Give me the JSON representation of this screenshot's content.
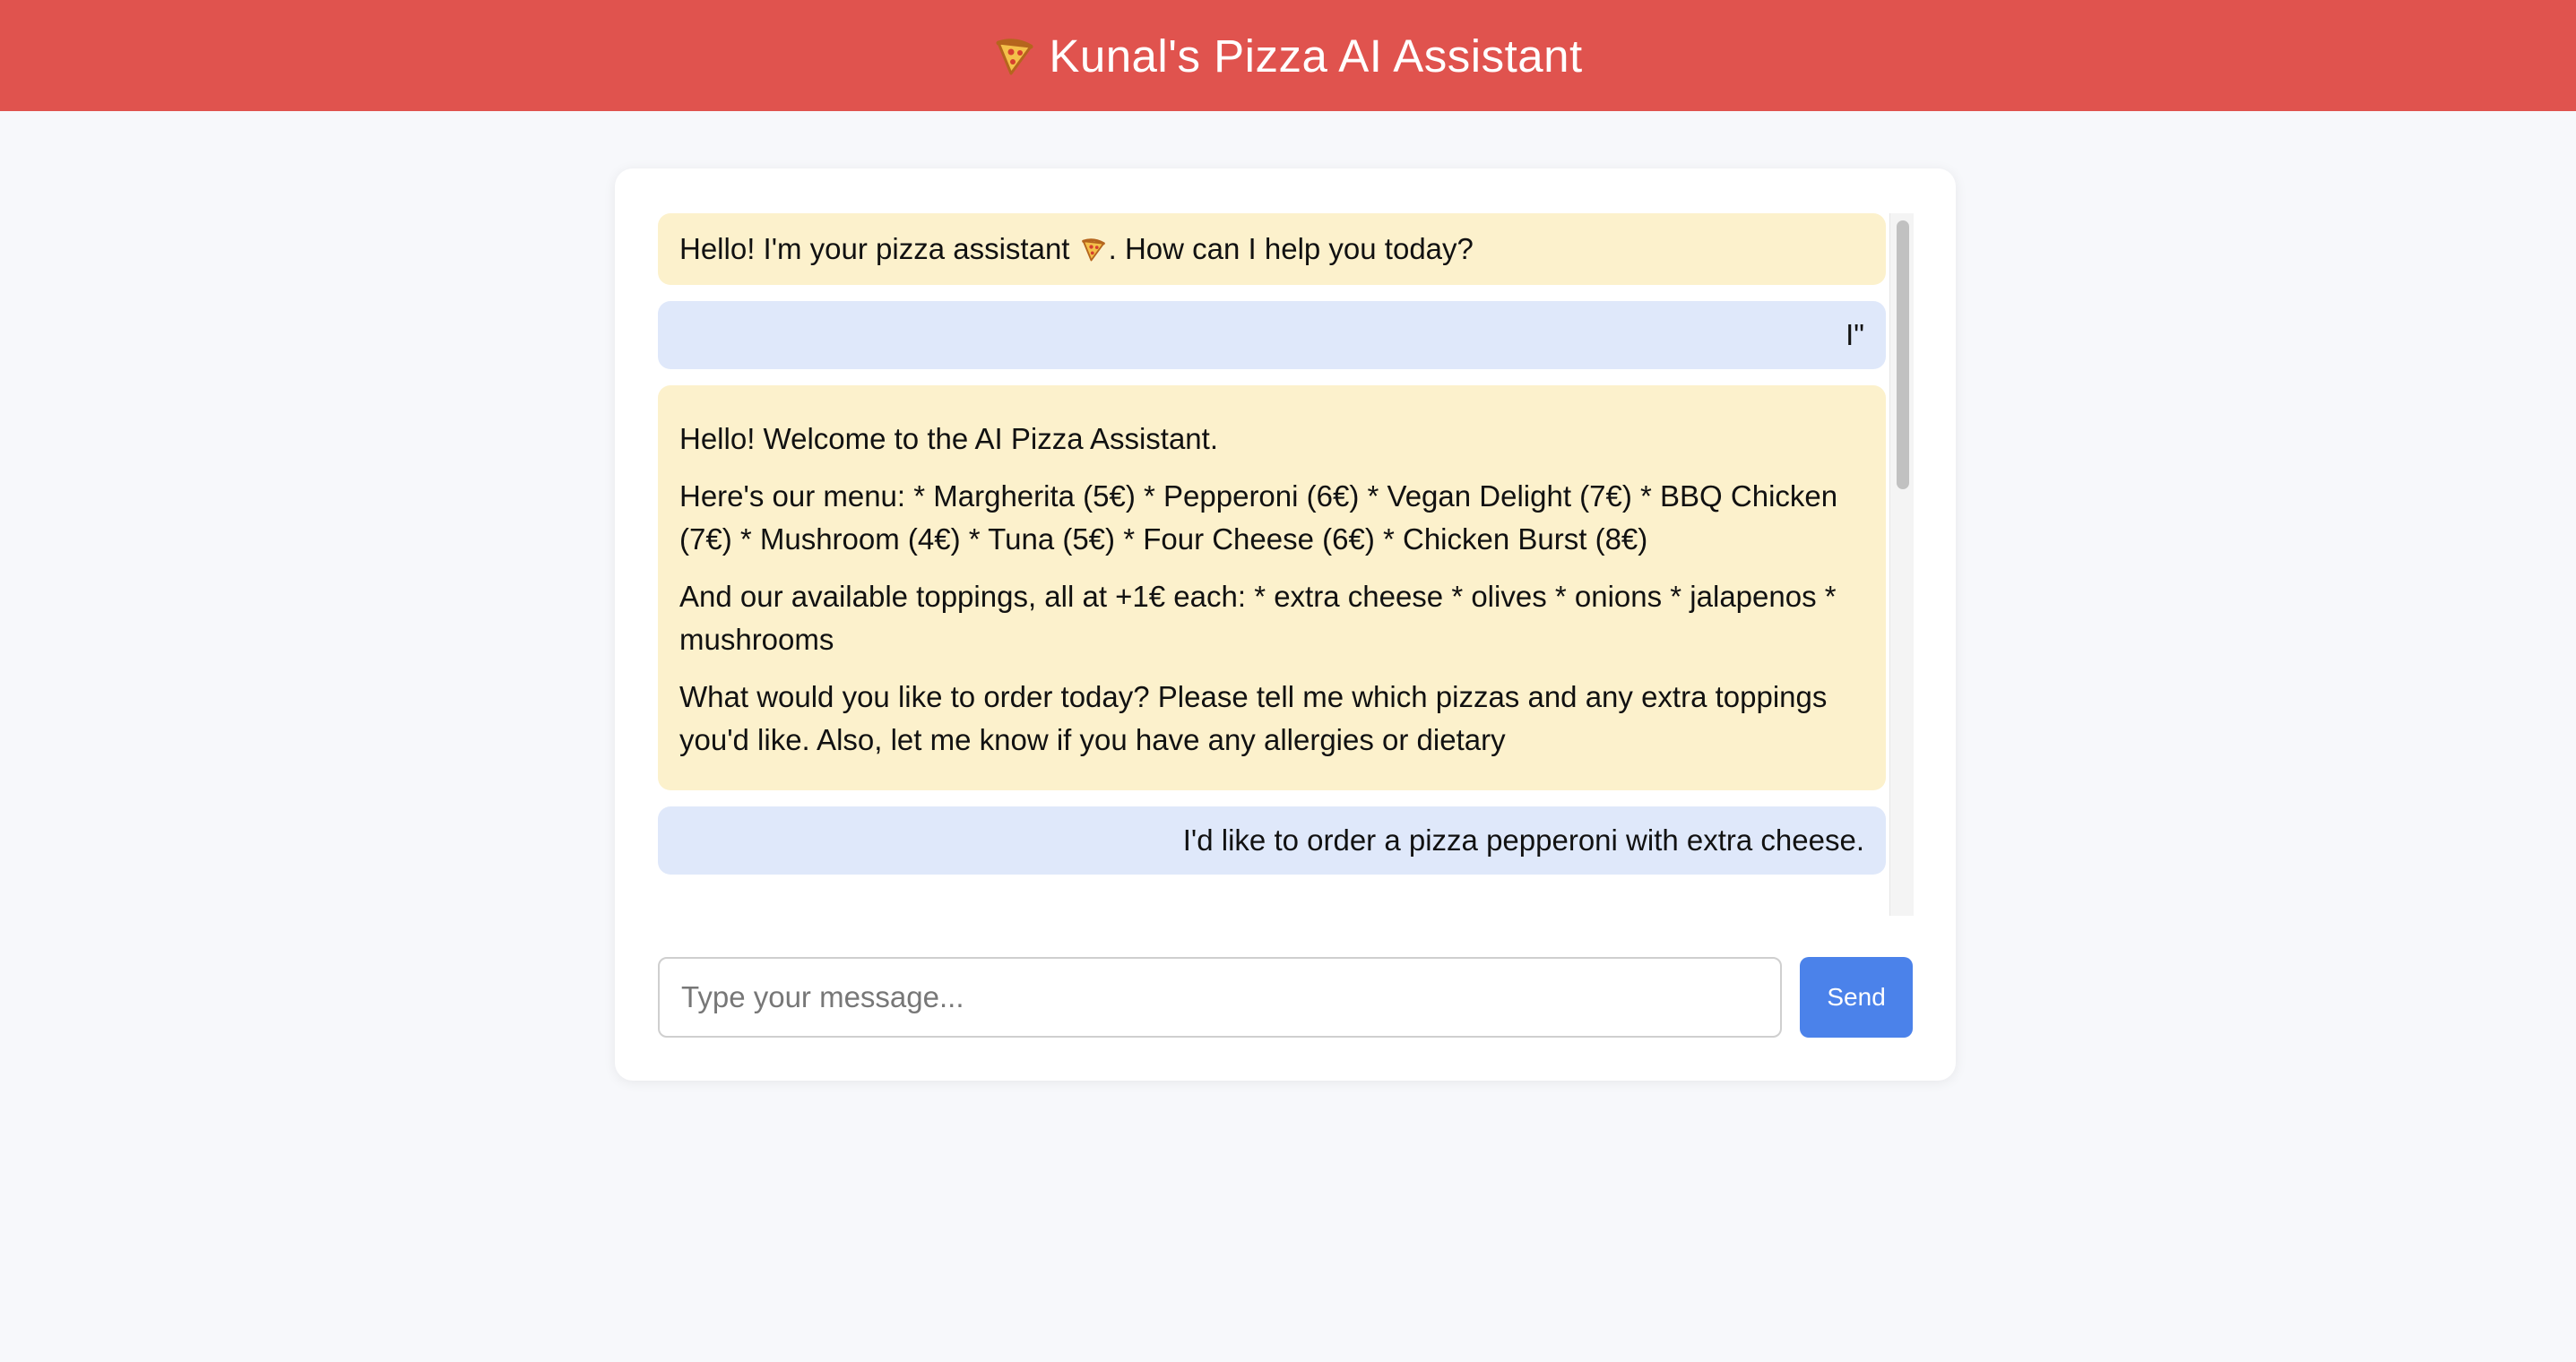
{
  "header": {
    "icon": "pizza-icon",
    "title": "Kunal's Pizza AI Assistant"
  },
  "chat": {
    "messages": [
      {
        "role": "bot",
        "before_icon": "Hello! I'm your pizza assistant",
        "icon": "pizza-icon",
        "after_icon": ". How can I help you today?"
      },
      {
        "role": "user",
        "text": "I\""
      },
      {
        "role": "bot",
        "paragraphs": [
          "Hello! Welcome to the AI Pizza Assistant.",
          "Here's our menu: * Margherita (5€) * Pepperoni (6€) * Vegan Delight (7€) * BBQ Chicken (7€) * Mushroom (4€) * Tuna (5€) * Four Cheese (6€) * Chicken Burst (8€)",
          "And our available toppings, all at +1€ each: * extra cheese * olives * onions * jalapenos * mushrooms",
          "What would you like to order today? Please tell me which pizzas and any extra toppings you'd like. Also, let me know if you have any allergies or dietary"
        ]
      },
      {
        "role": "user",
        "text": "I'd like to order a pizza pepperoni with extra cheese."
      }
    ]
  },
  "composer": {
    "placeholder": "Type your message...",
    "value": "",
    "send_label": "Send"
  },
  "colors": {
    "header_bg": "#e0534e",
    "bot_bubble": "#fcf1cc",
    "user_bubble": "#dfe8fa",
    "send_button": "#4b82ea"
  }
}
